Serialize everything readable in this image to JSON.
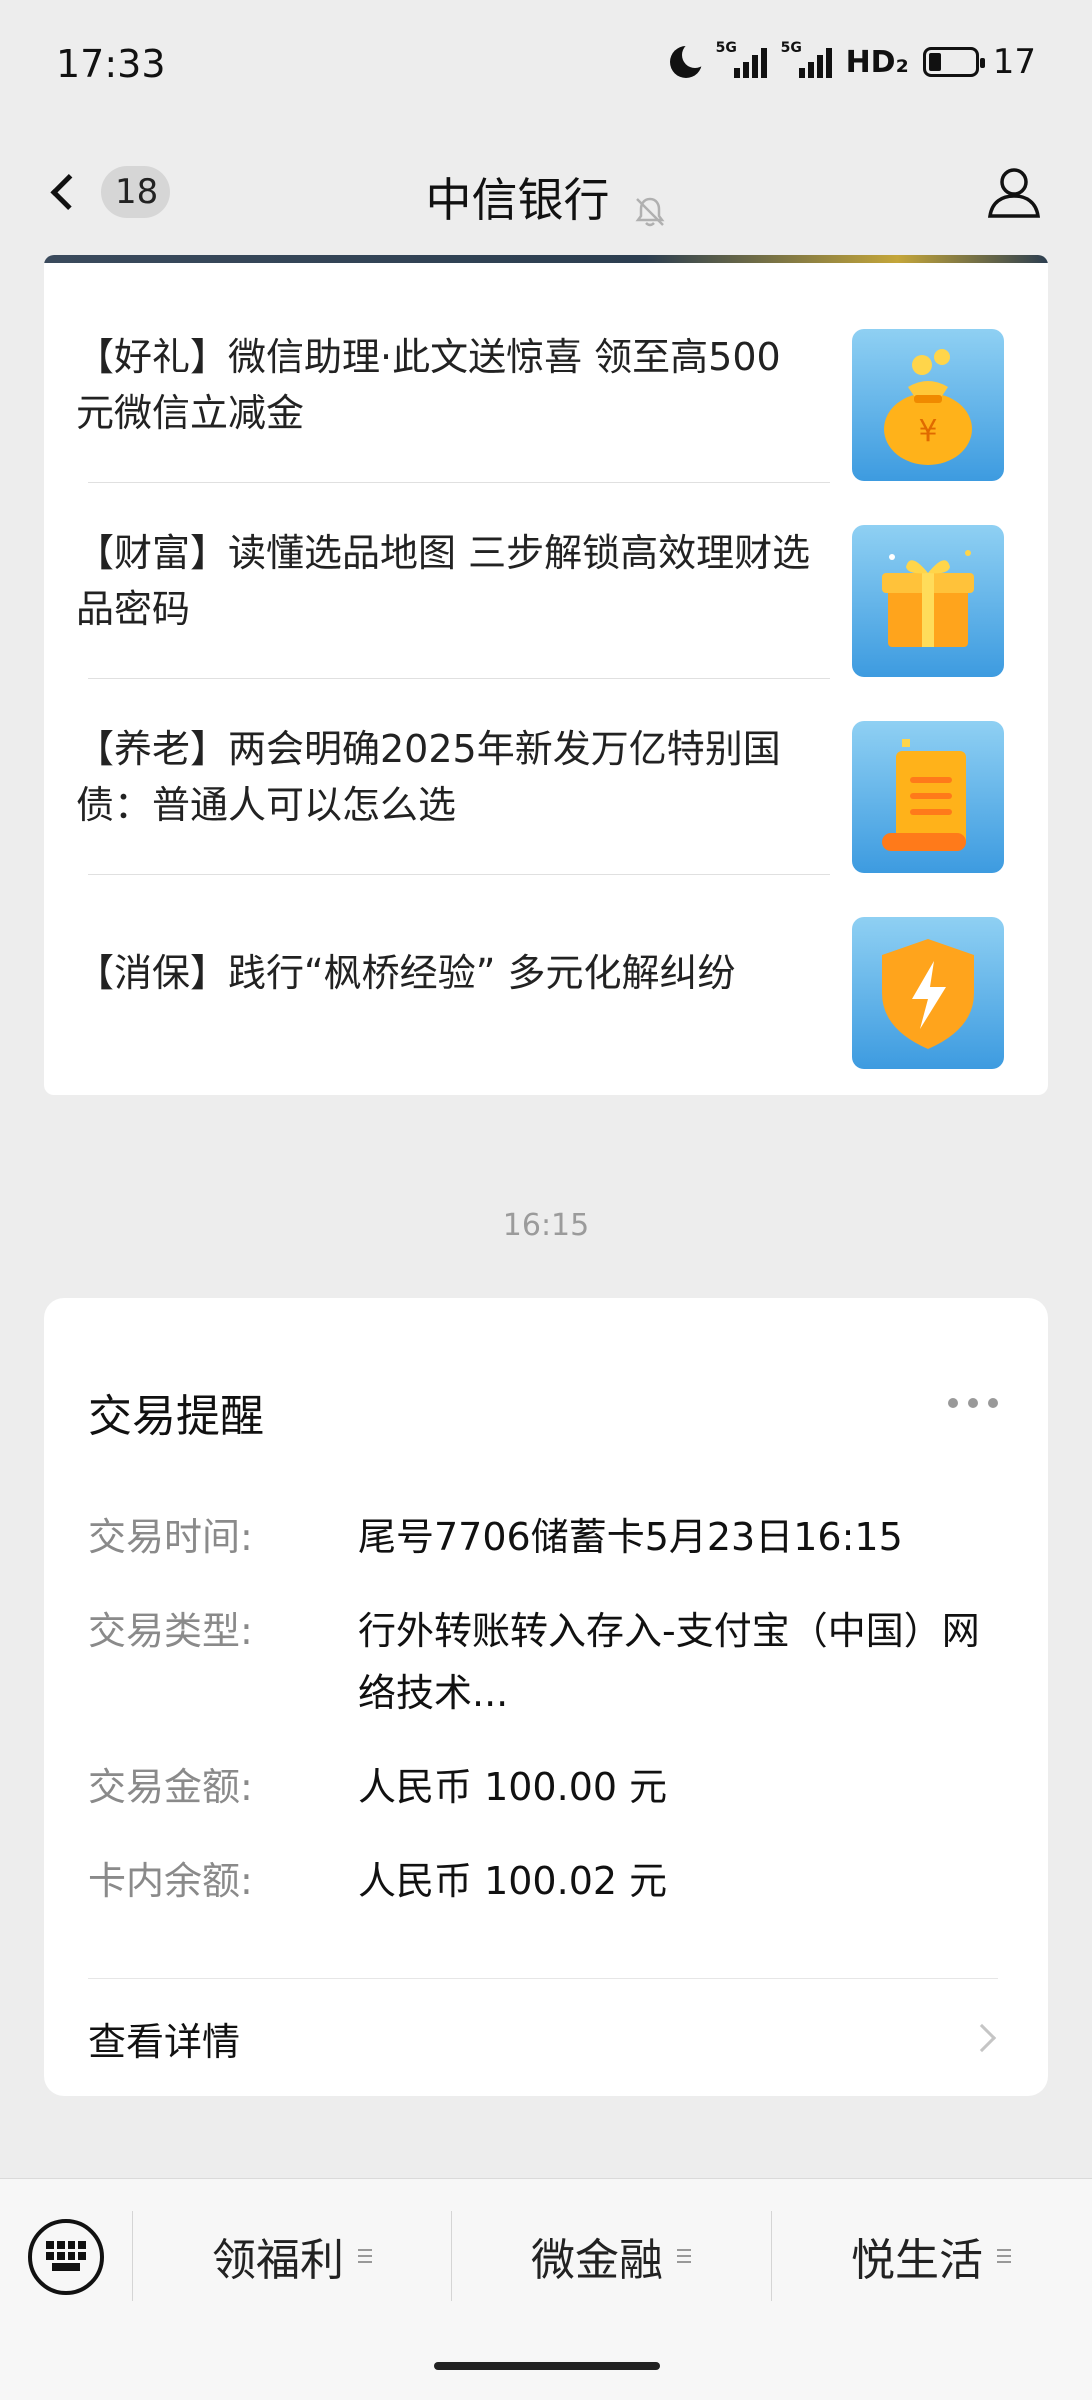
{
  "status_bar": {
    "time": "17:33",
    "signal_1_label": "5G",
    "signal_2_label": "5G",
    "hd_label": "HD₂",
    "battery_level": "17"
  },
  "nav": {
    "unread_count": "18",
    "title": "中信银行"
  },
  "articles": [
    {
      "text": "【好礼】微信助理·此文送惊喜 领至高500元微信立减金",
      "icon": "money-bag-icon"
    },
    {
      "text": "【财富】读懂选品地图 三步解锁高效理财选品密码",
      "icon": "gift-box-icon"
    },
    {
      "text": "【养老】两会明确2025年新发万亿特别国债：普通人可以怎么选",
      "icon": "scroll-document-icon"
    },
    {
      "text": "【消保】践行“枫桥经验” 多元化解纠纷",
      "icon": "shield-lightning-icon"
    }
  ],
  "message_time": "16:15",
  "transaction": {
    "title": "交易提醒",
    "rows": [
      {
        "key": "交易时间:",
        "value": "尾号7706储蓄卡5月23日16:15"
      },
      {
        "key": "交易类型:",
        "value": "行外转账转入存入-支付宝（中国）网络技术..."
      },
      {
        "key": "交易金额:",
        "value": "人民币 100.00 元"
      },
      {
        "key": "卡内余额:",
        "value": "人民币 100.02 元"
      }
    ],
    "detail_label": "查看详情"
  },
  "bottom_menu": {
    "items": [
      "领福利",
      "微金融",
      "悦生活"
    ]
  },
  "colors": {
    "background": "#ededed",
    "card": "#ffffff",
    "thumb_blue": "#3d9be0",
    "accent_orange": "#ff9a1f"
  }
}
